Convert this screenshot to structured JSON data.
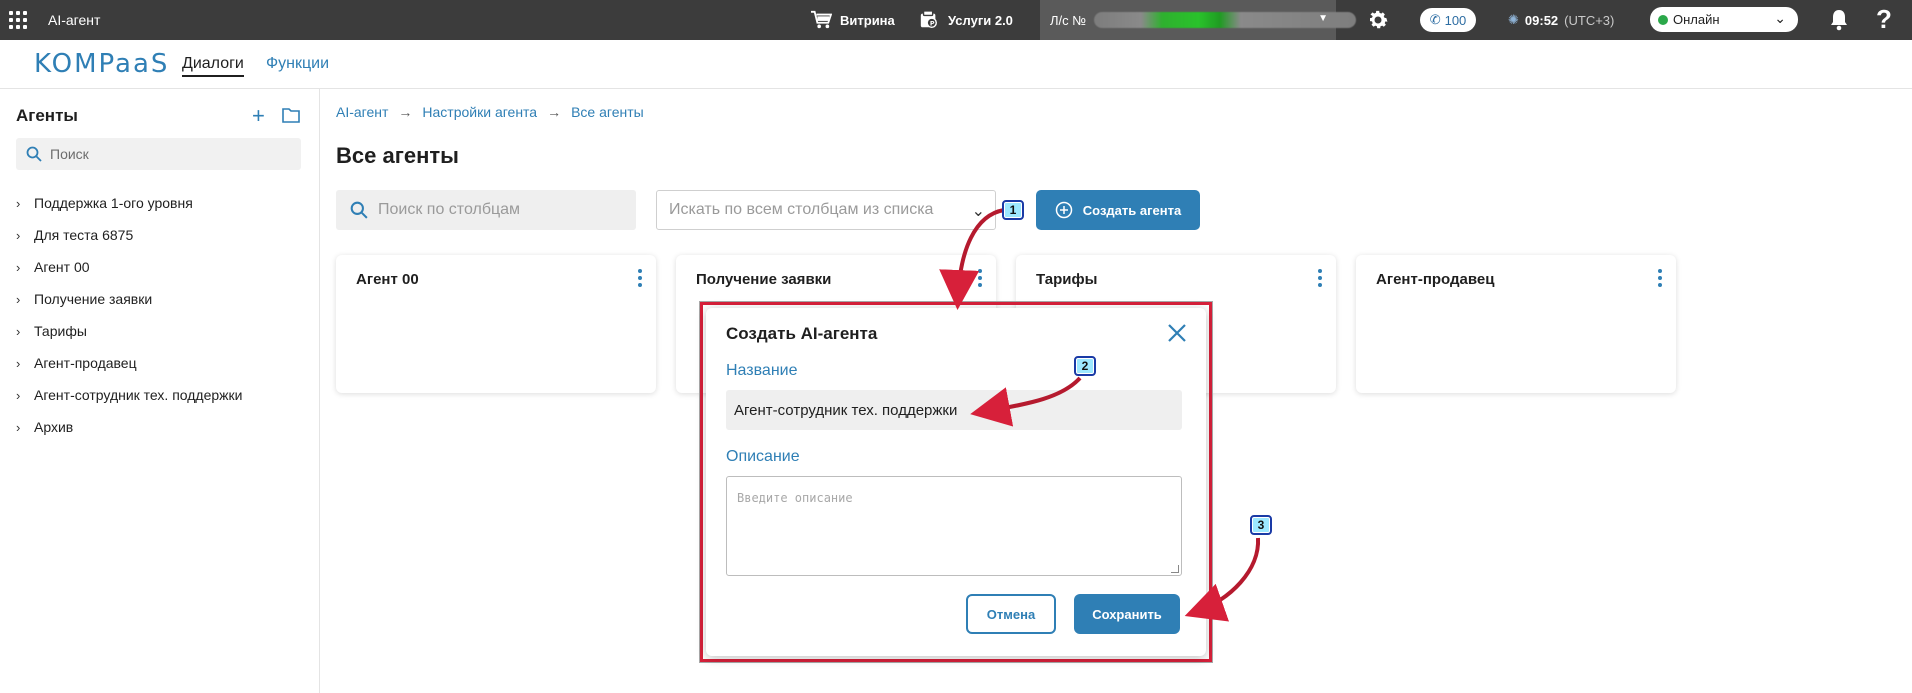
{
  "topbar": {
    "app_title": "AI-агент",
    "showcase_label": "Витрина",
    "services_label": "Услуги 2.0",
    "account_label": "Л/с №",
    "phone_count": "100",
    "time": "09:52",
    "timezone": "(UTC+3)",
    "status": "Онлайн",
    "help": "?"
  },
  "nav": {
    "logo": "KOMPaaS",
    "tabs": [
      "Диалоги",
      "Функции"
    ]
  },
  "sidebar": {
    "title": "Агенты",
    "search_placeholder": "Поиск",
    "items": [
      "Поддержка 1-ого уровня",
      "Для теста 6875",
      "Агент 00",
      "Получение заявки",
      "Тарифы",
      "Агент-продавец",
      "Агент-сотрудник тех. поддержки",
      "Архив"
    ]
  },
  "main": {
    "breadcrumbs": [
      "AI-агент",
      "Настройки агента",
      "Все агенты"
    ],
    "title": "Все агенты",
    "column_search_placeholder": "Поиск по столбцам",
    "all_search_placeholder": "Искать по всем столбцам из списка",
    "create_button": "Создать агента",
    "cards": [
      "Агент 00",
      "Получение заявки",
      "Тарифы",
      "Агент-продавец"
    ]
  },
  "modal": {
    "title": "Создать AI-агента",
    "name_label": "Название",
    "name_value": "Агент-сотрудник тех. поддержки",
    "description_label": "Описание",
    "description_placeholder": "Введите описание",
    "cancel": "Отмена",
    "save": "Сохранить"
  },
  "annotations": [
    "1",
    "2",
    "3"
  ],
  "colors": {
    "accent": "#2f7fb5",
    "topbar": "#3c3c3c",
    "highlight_frame": "#d7203a",
    "online": "#2ba84a"
  }
}
